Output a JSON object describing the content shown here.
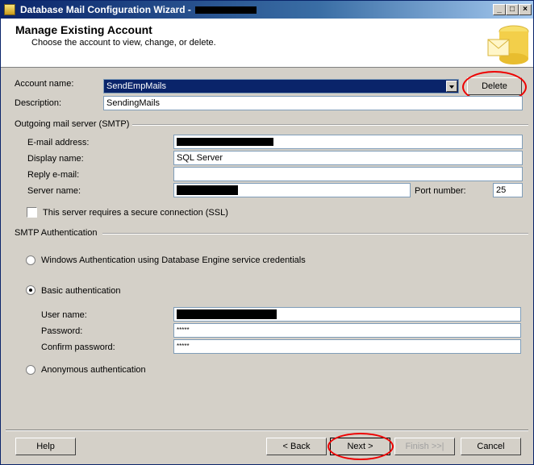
{
  "window": {
    "title": "Database Mail Configuration Wizard -"
  },
  "header": {
    "title": "Manage Existing Account",
    "subtitle": "Choose the account to view, change, or delete."
  },
  "account": {
    "name_label": "Account name:",
    "name_value": "SendEmpMails",
    "delete_label": "Delete",
    "description_label": "Description:",
    "description_value": "SendingMails"
  },
  "smtp": {
    "group_label": "Outgoing mail server (SMTP)",
    "email_label": "E-mail address:",
    "display_label": "Display name:",
    "display_value": "SQL Server",
    "reply_label": "Reply e-mail:",
    "reply_value": "",
    "server_label": "Server name:",
    "port_label": "Port number:",
    "port_value": "25",
    "ssl_label": "This server requires a secure connection (SSL)",
    "ssl_checked": false
  },
  "auth": {
    "group_label": "SMTP Authentication",
    "windows_label": "Windows Authentication using Database Engine service credentials",
    "basic_label": "Basic authentication",
    "selected": "basic",
    "user_label": "User name:",
    "password_label": "Password:",
    "password_value": "*****",
    "confirm_label": "Confirm password:",
    "confirm_value": "*****",
    "anonymous_label": "Anonymous authentication"
  },
  "footer": {
    "help_label": "Help",
    "back_label": "< Back",
    "next_label": "Next >",
    "finish_label": "Finish >>|",
    "cancel_label": "Cancel"
  },
  "colors": {
    "titlebar_start": "#0a246a",
    "annotation": "#e00000"
  }
}
